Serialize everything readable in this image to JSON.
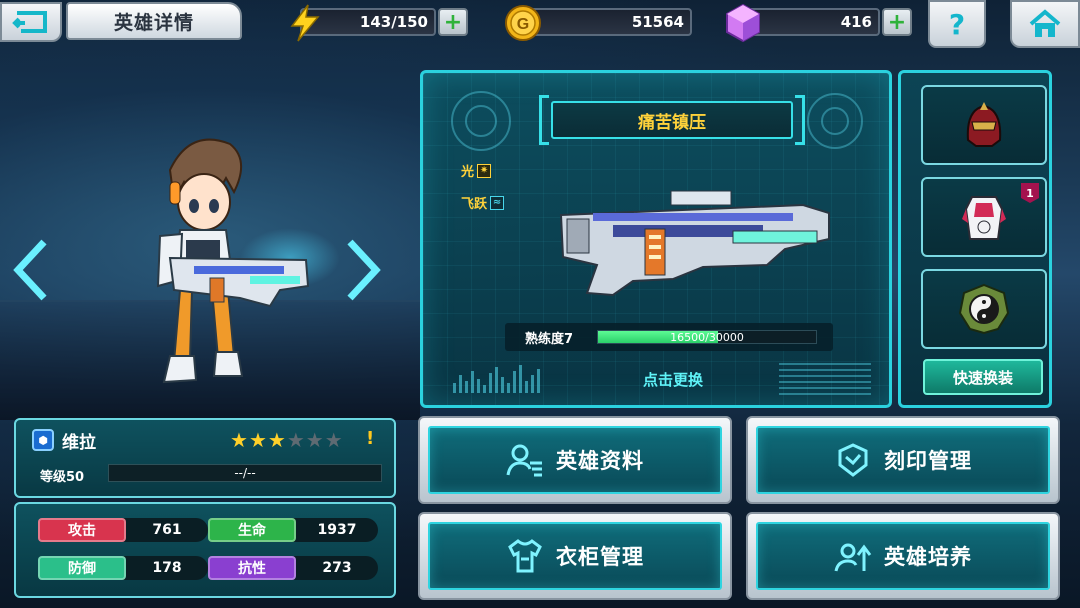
{
  "header": {
    "title": "英雄详情",
    "energy": "143/150",
    "gold": "51564",
    "gems": "416"
  },
  "weapon": {
    "name": "痛苦镇压",
    "attr_light_label": "光",
    "attr_leap_label": "飞跃",
    "proficiency_label": "熟练度7",
    "proficiency_value": "16500/30000",
    "proficiency_ratio": 0.55,
    "tap_change_label": "点击更换"
  },
  "equipment": {
    "slot2_badge": "1",
    "quick_swap_label": "快速换装"
  },
  "hero": {
    "name": "维拉",
    "stars_filled": 3,
    "stars_total": 6,
    "warning": "!",
    "level_label": "等级50",
    "level_progress": "--/--"
  },
  "stats": {
    "attack_label": "攻击",
    "attack_value": "761",
    "hp_label": "生命",
    "hp_value": "1937",
    "defense_label": "防御",
    "defense_value": "178",
    "resist_label": "抗性",
    "resist_value": "273"
  },
  "menu": {
    "hero_info": "英雄资料",
    "imprint_manage": "刻印管理",
    "wardrobe_manage": "衣柜管理",
    "hero_train": "英雄培养"
  },
  "colors": {
    "accent": "#2bd2df",
    "weapon_name": "#ffd23a",
    "attack": "#d8344e",
    "hp": "#2db44a",
    "defense": "#2bbf8a",
    "resist": "#8a3fd0"
  }
}
